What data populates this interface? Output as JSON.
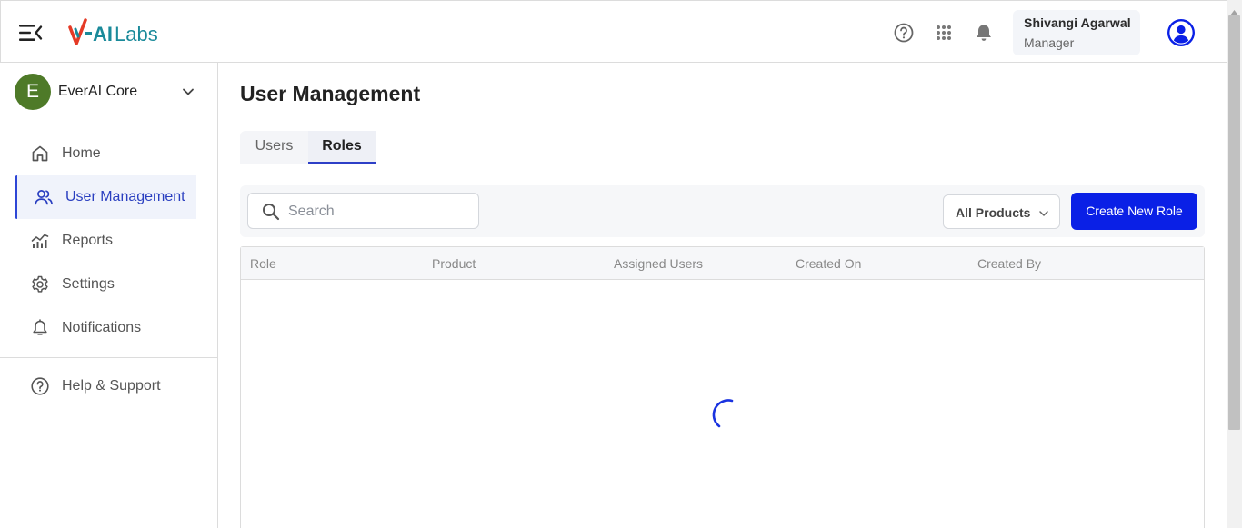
{
  "app": {
    "logo_text": "V-AI Labs",
    "colors": {
      "accent": "#0a20e6",
      "active_nav": "#2a3fc0",
      "org_avatar": "#4e7a28",
      "logo_red": "#e53a26",
      "logo_teal": "#1a8a9a"
    }
  },
  "header": {
    "icons": [
      "menu-collapse-icon",
      "help-icon",
      "apps-grid-icon",
      "bell-icon",
      "user-avatar-icon"
    ],
    "user": {
      "name": "Shivangi Agarwal",
      "role": "Manager"
    }
  },
  "sidebar": {
    "org": {
      "initial": "E",
      "name": "EverAI Core"
    },
    "items": [
      {
        "label": "Home",
        "icon": "home-icon",
        "active": false
      },
      {
        "label": "User Management",
        "icon": "users-icon",
        "active": true
      },
      {
        "label": "Reports",
        "icon": "reports-icon",
        "active": false
      },
      {
        "label": "Settings",
        "icon": "gear-icon",
        "active": false
      },
      {
        "label": "Notifications",
        "icon": "bell-icon",
        "active": false
      }
    ],
    "help": {
      "label": "Help & Support",
      "icon": "help-icon"
    }
  },
  "main": {
    "title": "User Management",
    "tabs": [
      {
        "label": "Users",
        "selected": false
      },
      {
        "label": "Roles",
        "selected": true
      }
    ],
    "search": {
      "placeholder": "Search",
      "value": ""
    },
    "product_filter": {
      "selected": "All Products"
    },
    "create_button": "Create New Role",
    "table": {
      "columns": [
        "Role",
        "Product",
        "Assigned Users",
        "Created On",
        "Created By"
      ],
      "rows": [],
      "loading": true
    }
  }
}
